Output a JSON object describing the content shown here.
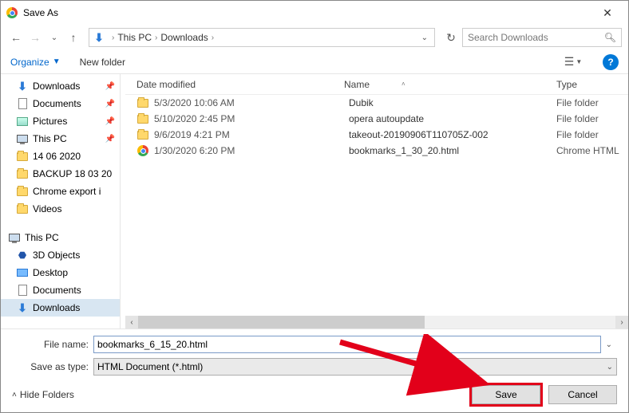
{
  "titlebar": {
    "title": "Save As"
  },
  "nav": {
    "breadcrumb": [
      "This PC",
      "Downloads"
    ],
    "search_placeholder": "Search Downloads"
  },
  "toolbar": {
    "organize": "Organize",
    "new_folder": "New folder"
  },
  "sidebar": {
    "quick": [
      {
        "label": "Downloads",
        "icon": "download",
        "pinned": true
      },
      {
        "label": "Documents",
        "icon": "document",
        "pinned": true
      },
      {
        "label": "Pictures",
        "icon": "picture",
        "pinned": true
      },
      {
        "label": "This PC",
        "icon": "pc",
        "pinned": true
      },
      {
        "label": "14 06 2020",
        "icon": "folder",
        "pinned": false
      },
      {
        "label": "BACKUP 18 03 20",
        "icon": "folder",
        "pinned": false
      },
      {
        "label": "Chrome export i",
        "icon": "folder",
        "pinned": false
      },
      {
        "label": "Videos",
        "icon": "folder",
        "pinned": false
      }
    ],
    "thispc_label": "This PC",
    "thispc": [
      {
        "label": "3D Objects",
        "icon": "obj"
      },
      {
        "label": "Desktop",
        "icon": "desktop"
      },
      {
        "label": "Documents",
        "icon": "document"
      },
      {
        "label": "Downloads",
        "icon": "download",
        "active": true
      }
    ]
  },
  "columns": {
    "date": "Date modified",
    "name": "Name",
    "type": "Type"
  },
  "rows": [
    {
      "icon": "folder",
      "date": "5/3/2020 10:06 AM",
      "name": "Dubik",
      "type": "File folder"
    },
    {
      "icon": "folder",
      "date": "5/10/2020 2:45 PM",
      "name": "opera autoupdate",
      "type": "File folder"
    },
    {
      "icon": "folder",
      "date": "9/6/2019 4:21 PM",
      "name": "takeout-20190906T110705Z-002",
      "type": "File folder"
    },
    {
      "icon": "chrome",
      "date": "1/30/2020 6:20 PM",
      "name": "bookmarks_1_30_20.html",
      "type": "Chrome HTML"
    }
  ],
  "form": {
    "filename_label": "File name:",
    "filename_value": "bookmarks_6_15_20.html",
    "type_label": "Save as type:",
    "type_value": "HTML Document (*.html)"
  },
  "footer": {
    "hide_folders": "Hide Folders",
    "save": "Save",
    "cancel": "Cancel"
  }
}
